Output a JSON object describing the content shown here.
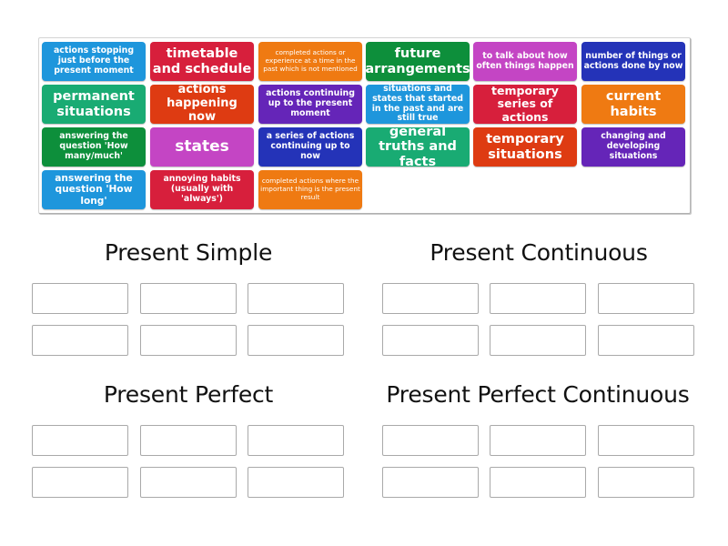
{
  "tiles": [
    {
      "text": "actions stopping just before the present moment",
      "color": "#1e96dc"
    },
    {
      "text": "timetable and schedule",
      "color": "#d71f3c"
    },
    {
      "text": "completed actions or experience at a time in the past which is not mentioned",
      "color": "#ef7a12"
    },
    {
      "text": "future arrangements",
      "color": "#0d8f3b"
    },
    {
      "text": "to talk about how often things happen",
      "color": "#c445c4"
    },
    {
      "text": "number of things or actions done by now",
      "color": "#2433b8"
    },
    {
      "text": "permanent situations",
      "color": "#19ab73"
    },
    {
      "text": "actions happening now",
      "color": "#de3b12"
    },
    {
      "text": "actions continuing up to the present moment",
      "color": "#6525b8"
    },
    {
      "text": "situations and states that started in the past and are still true",
      "color": "#1e96dc"
    },
    {
      "text": "temporary series of actions",
      "color": "#d71f3c"
    },
    {
      "text": "current habits",
      "color": "#ef7a12"
    },
    {
      "text": "answering the question 'How many/much'",
      "color": "#0d8f3b"
    },
    {
      "text": "states",
      "color": "#c445c4"
    },
    {
      "text": "a series of actions continuing up to now",
      "color": "#2433b8"
    },
    {
      "text": "general truths and facts",
      "color": "#19ab73"
    },
    {
      "text": "temporary situations",
      "color": "#de3b12"
    },
    {
      "text": "changing and developing situations",
      "color": "#6525b8"
    },
    {
      "text": "answering the question 'How long'",
      "color": "#1e96dc"
    },
    {
      "text": "annoying habits (usually with 'always')",
      "color": "#d71f3c"
    },
    {
      "text": "completed actions where the important thing is the present result",
      "color": "#ef7a12"
    }
  ],
  "groups": [
    {
      "title": "Present Simple",
      "slots": 6
    },
    {
      "title": "Present Continuous",
      "slots": 6
    },
    {
      "title": "Present Perfect",
      "slots": 6
    },
    {
      "title": "Present Perfect Continuous",
      "slots": 6
    }
  ]
}
